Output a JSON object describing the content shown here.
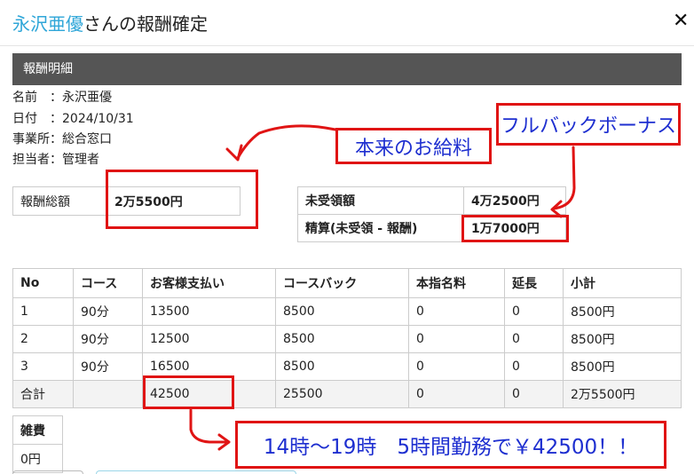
{
  "modal": {
    "title_name": "永沢亜優",
    "title_suffix": "さんの報酬確定",
    "close_label": "✕"
  },
  "section": {
    "title": "報酬明細"
  },
  "info": {
    "name_line": "名前　：永沢亜優",
    "date_line": "日付　：2024/10/31",
    "office_line": "事業所：総合窓口",
    "staff_line": "担当者：管理者"
  },
  "total_table": {
    "label": "報酬総額",
    "value": "2万5500円"
  },
  "unpaid_table": {
    "unpaid_label": "未受領額",
    "unpaid_value": "4万2500円",
    "settle_label": "精算(未受領 - 報酬)",
    "settle_value": "1万7000円"
  },
  "detail_table": {
    "headers": [
      "No",
      "コース",
      "お客様支払い",
      "コースバック",
      "本指名料",
      "延長",
      "小計"
    ],
    "rows": [
      [
        "1",
        "90分",
        "13500",
        "8500",
        "0",
        "0",
        "8500円"
      ],
      [
        "2",
        "90分",
        "12500",
        "8500",
        "0",
        "0",
        "8500円"
      ],
      [
        "3",
        "90分",
        "16500",
        "8500",
        "0",
        "0",
        "8500円"
      ]
    ],
    "total_row": [
      "合計",
      "",
      "42500",
      "25500",
      "0",
      "0",
      "2万5500円"
    ]
  },
  "misc_table": {
    "header": "雑費",
    "value": "0円"
  },
  "annotations": {
    "original_pay": "本来のお給料",
    "full_back": "フルバックボーナス",
    "work_summary": "14時〜19時　5時間勤務で￥42500！！",
    "color": "#e01414",
    "text_color": "#1e2fd0"
  },
  "colors": {
    "accent": "#2fa6d8",
    "section_bar": "#555555"
  }
}
